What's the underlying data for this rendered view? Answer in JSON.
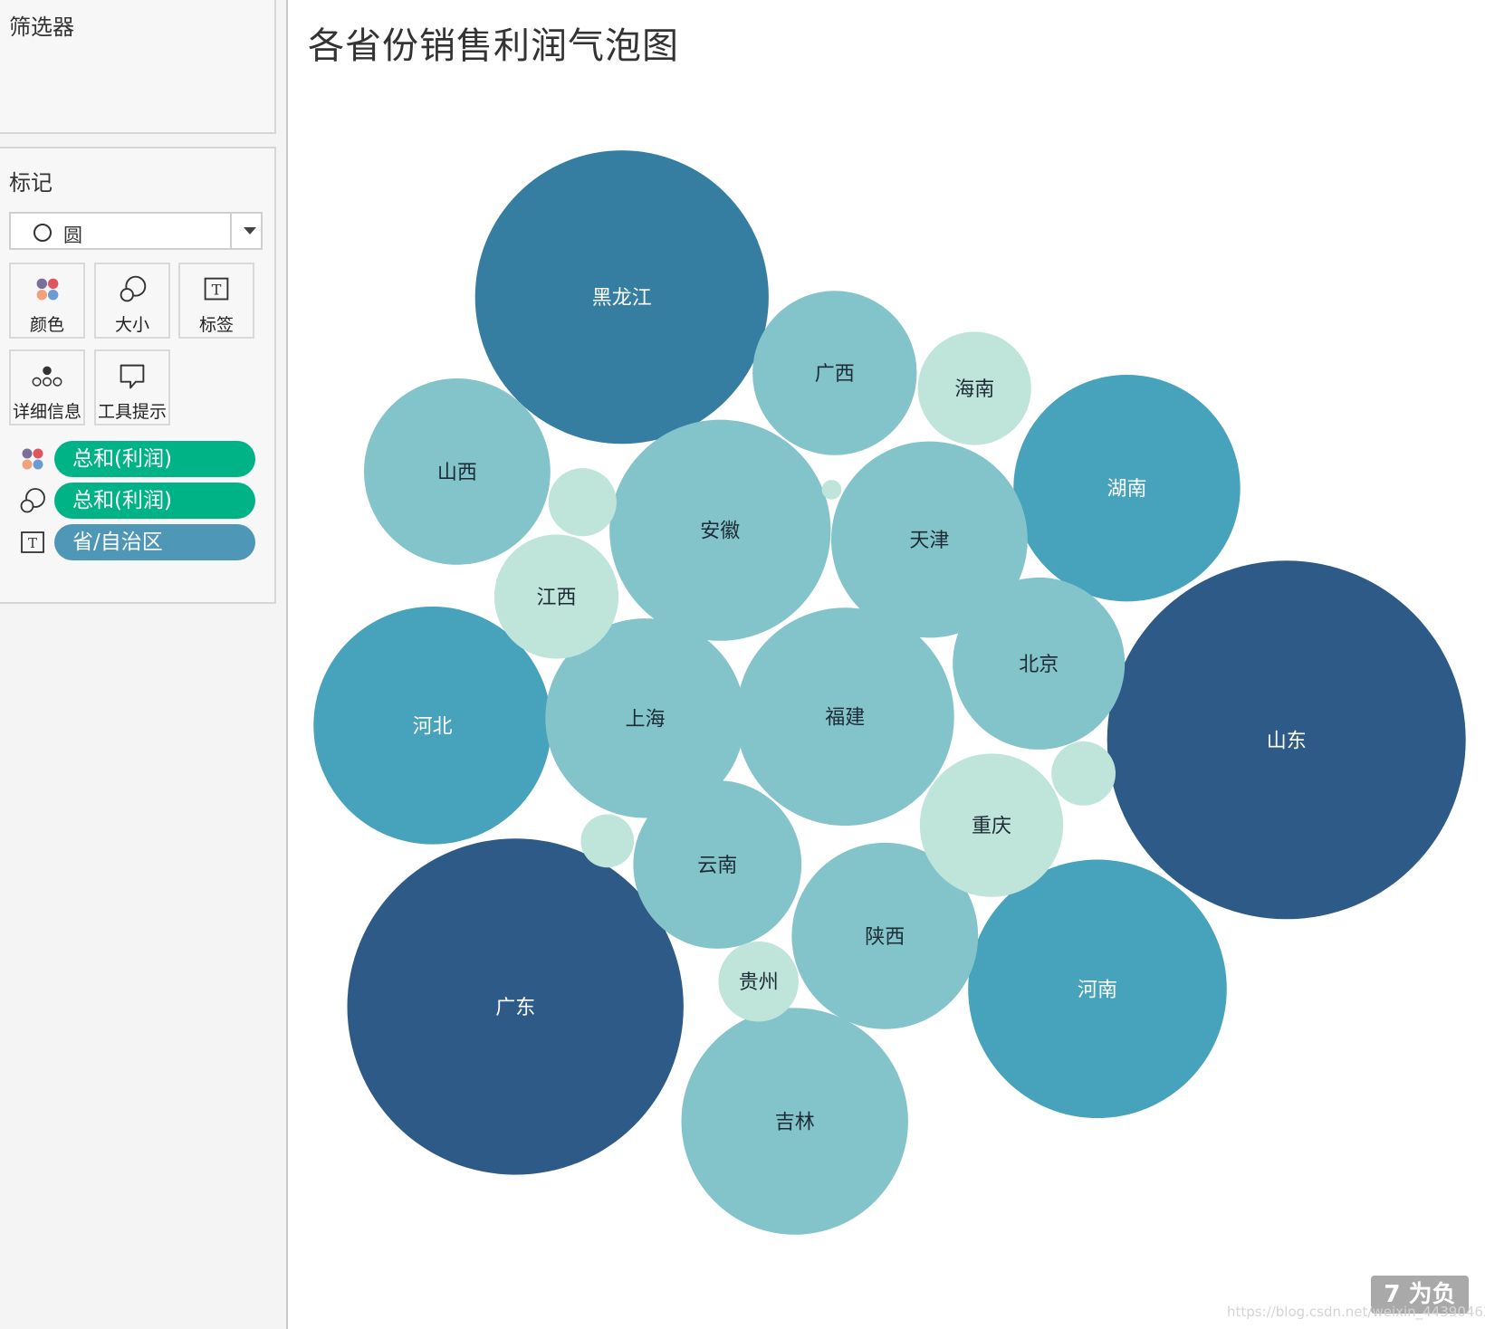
{
  "sidebar": {
    "filter_title": "筛选器",
    "marks_title": "标记",
    "mark_type": "圆",
    "buttons": [
      {
        "label": "颜色",
        "icon": "color-dots-icon"
      },
      {
        "label": "大小",
        "icon": "size-circles-icon"
      },
      {
        "label": "标签",
        "icon": "label-t-icon"
      },
      {
        "label": "详细信息",
        "icon": "detail-dots-icon"
      },
      {
        "label": "工具提示",
        "icon": "tooltip-bubble-icon"
      }
    ],
    "pills": [
      {
        "label": "总和(利润)",
        "icon": "color-dots-icon",
        "color": "#00b386"
      },
      {
        "label": "总和(利润)",
        "icon": "size-circles-icon",
        "color": "#00b386"
      },
      {
        "label": "省/自治区",
        "icon": "label-t-icon",
        "color": "#4e97b6"
      }
    ]
  },
  "chart_data": {
    "type": "bubble",
    "title": "各省份销售利润气泡图",
    "colors": {
      "darkest": "#2e5a87",
      "dark": "#367ea1",
      "mid": "#47a2bb",
      "light": "#83c3ca",
      "lightest": "#bfe5da",
      "label_dark_text": "#1d2b36",
      "label_light_text": "#ffffff"
    },
    "bubbles": [
      {
        "label": "山东",
        "value": 100,
        "shade": "darkest"
      },
      {
        "label": "广东",
        "value": 88,
        "shade": "darkest"
      },
      {
        "label": "黑龙江",
        "value": 67,
        "shade": "dark"
      },
      {
        "label": "河南",
        "value": 52,
        "shade": "mid"
      },
      {
        "label": "河北",
        "value": 44,
        "shade": "mid"
      },
      {
        "label": "湖南",
        "value": 40,
        "shade": "mid"
      },
      {
        "label": "吉林",
        "value": 40,
        "shade": "light"
      },
      {
        "label": "安徽",
        "value": 38,
        "shade": "light"
      },
      {
        "label": "福建",
        "value": 37,
        "shade": "light"
      },
      {
        "label": "上海",
        "value": 31,
        "shade": "light"
      },
      {
        "label": "天津",
        "value": 30,
        "shade": "light"
      },
      {
        "label": "陕西",
        "value": 27,
        "shade": "light"
      },
      {
        "label": "山西",
        "value": 27,
        "shade": "light"
      },
      {
        "label": "北京",
        "value": 23,
        "shade": "light"
      },
      {
        "label": "云南",
        "value": 22,
        "shade": "light"
      },
      {
        "label": "广西",
        "value": 21,
        "shade": "light"
      },
      {
        "label": "重庆",
        "value": 16,
        "shade": "lightest"
      },
      {
        "label": "江西",
        "value": 12,
        "shade": "lightest"
      },
      {
        "label": "海南",
        "value": 10,
        "shade": "lightest"
      },
      {
        "label": "贵州",
        "value": 5,
        "shade": "lightest"
      },
      {
        "label": "",
        "value": 3.6,
        "shade": "lightest"
      },
      {
        "label": "",
        "value": 3.2,
        "shade": "lightest"
      },
      {
        "label": "",
        "value": 2.2,
        "shade": "lightest"
      },
      {
        "label": "",
        "value": 0.3,
        "shade": "lightest"
      }
    ]
  },
  "watermark": {
    "badge": "7 为负",
    "url": "https://blog.csdn.net/weixin_44390462"
  }
}
